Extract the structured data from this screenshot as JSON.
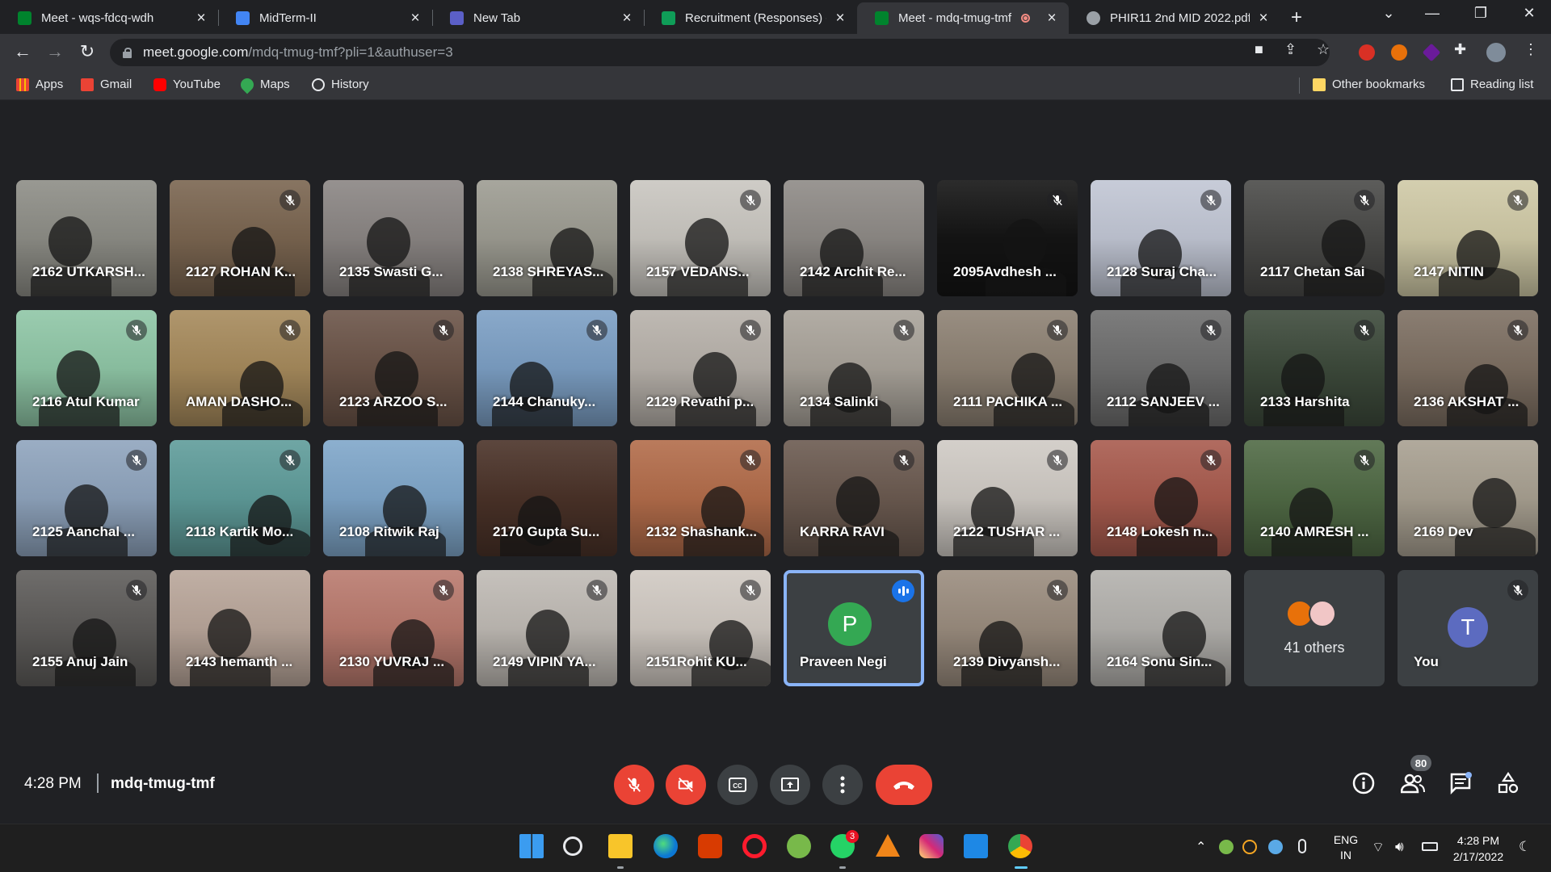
{
  "browser": {
    "tabs": [
      {
        "title": "Meet - wqs-fdcq-wdh",
        "active": false,
        "favicon_color": "#00832d"
      },
      {
        "title": "MidTerm-II",
        "active": false,
        "favicon_color": "#4285f4"
      },
      {
        "title": "New Tab",
        "active": false,
        "favicon_color": "#5b5fc7"
      },
      {
        "title": "Recruitment (Responses) - (",
        "active": false,
        "favicon_color": "#0f9d58"
      },
      {
        "title": "Meet - mdq-tmug-tmf",
        "active": true,
        "favicon_color": "#00832d"
      },
      {
        "title": "PHIR11 2nd MID 2022.pdf",
        "active": false,
        "favicon_color": "#9aa0a6"
      }
    ],
    "url_host": "meet.google.com",
    "url_path": "/mdq-tmug-tmf?pli=1&authuser=3",
    "bookmarks": [
      {
        "label": "Apps",
        "icon": "apps-grid-icon"
      },
      {
        "label": "Gmail",
        "icon": "gmail-icon"
      },
      {
        "label": "YouTube",
        "icon": "youtube-icon"
      },
      {
        "label": "Maps",
        "icon": "maps-icon"
      },
      {
        "label": "History",
        "icon": "history-icon"
      }
    ],
    "other_bookmarks": "Other bookmarks",
    "reading_list": "Reading list"
  },
  "meeting": {
    "time": "4:28 PM",
    "code": "mdq-tmug-tmf",
    "participant_count": "80",
    "others_label": "41 others",
    "you_label": "You",
    "you_initial": "T",
    "speaker_initial": "P"
  },
  "participants": [
    {
      "name": "2162 UTKARSH...",
      "muted": false,
      "bg": "#8d8d86"
    },
    {
      "name": "2127 ROHAN K...",
      "muted": true,
      "bg": "#7a6550"
    },
    {
      "name": "2135 Swasti G...",
      "muted": false,
      "bg": "#8a8583"
    },
    {
      "name": "2138 SHREYAS...",
      "muted": false,
      "bg": "#9d9c92"
    },
    {
      "name": "2157 VEDANS...",
      "muted": true,
      "bg": "#c9c6c0"
    },
    {
      "name": "2142 Archit Re...",
      "muted": false,
      "bg": "#8e8a86"
    },
    {
      "name": "2095Avdhesh ...",
      "muted": true,
      "bg": "#141414"
    },
    {
      "name": "2128 Suraj Cha...",
      "muted": true,
      "bg": "#c1c6d4"
    },
    {
      "name": "2117 Chetan Sai",
      "muted": true,
      "bg": "#4a4a48"
    },
    {
      "name": "2147 NITIN",
      "muted": true,
      "bg": "#cfc9a6"
    },
    {
      "name": "2116 Atul Kumar",
      "muted": true,
      "bg": "#8fc6a6"
    },
    {
      "name": "AMAN DASHO...",
      "muted": true,
      "bg": "#a68a5c"
    },
    {
      "name": "2123 ARZOO S...",
      "muted": true,
      "bg": "#6b5448"
    },
    {
      "name": "2144 Chanuky...",
      "muted": true,
      "bg": "#7c9fc4"
    },
    {
      "name": "2129 Revathi p...",
      "muted": true,
      "bg": "#b7b1aa"
    },
    {
      "name": "2134 Salinki",
      "muted": true,
      "bg": "#a9a39a"
    },
    {
      "name": "2111 PACHIKA ...",
      "muted": true,
      "bg": "#8d8173"
    },
    {
      "name": "2112 SANJEEV ...",
      "muted": true,
      "bg": "#6e6e6e"
    },
    {
      "name": "2133 Harshita",
      "muted": true,
      "bg": "#3d4a3b"
    },
    {
      "name": "2136 AKSHAT ...",
      "muted": true,
      "bg": "#7d6f62"
    },
    {
      "name": "2125 Aanchal ...",
      "muted": true,
      "bg": "#8fa4bd"
    },
    {
      "name": "2118 Kartik Mo...",
      "muted": true,
      "bg": "#5f9c9a"
    },
    {
      "name": "2108 Ritwik Raj",
      "muted": false,
      "bg": "#7fa6c9"
    },
    {
      "name": "2170 Gupta Su...",
      "muted": false,
      "bg": "#4a3228"
    },
    {
      "name": "2132 Shashank...",
      "muted": true,
      "bg": "#b26c4a"
    },
    {
      "name": "KARRA RAVI",
      "muted": true,
      "bg": "#6b5a50"
    },
    {
      "name": "2122 TUSHAR ...",
      "muted": true,
      "bg": "#cfcac4"
    },
    {
      "name": "2148 Lokesh n...",
      "muted": true,
      "bg": "#a85b4e"
    },
    {
      "name": "2140 AMRESH ...",
      "muted": true,
      "bg": "#506a45"
    },
    {
      "name": "2169 Dev",
      "muted": false,
      "bg": "#a8a091"
    },
    {
      "name": "2155 Anuj Jain",
      "muted": true,
      "bg": "#5e5c5a"
    },
    {
      "name": "2143 hemanth ...",
      "muted": false,
      "bg": "#b9a69a"
    },
    {
      "name": "2130 YUVRAJ ...",
      "muted": true,
      "bg": "#b97a6e"
    },
    {
      "name": "2149 VIPIN YA...",
      "muted": true,
      "bg": "#bfbab4"
    },
    {
      "name": "2151Rohit KU...",
      "muted": true,
      "bg": "#d0c9c2"
    },
    {
      "name": "Praveen Negi",
      "muted": false,
      "bg": "#3c4043"
    },
    {
      "name": "2139 Divyansh...",
      "muted": true,
      "bg": "#9a8c7e"
    },
    {
      "name": "2164 Sonu Sin...",
      "muted": false,
      "bg": "#b3b1ad"
    }
  ],
  "taskbar": {
    "language": "ENG",
    "region": "IN",
    "time": "4:28 PM",
    "date": "2/17/2022",
    "whatsapp_badge": "3"
  },
  "colors": {
    "background": "#202124",
    "red": "#ea4335",
    "blue": "#1a73e8",
    "avatar_green": "#34a853",
    "avatar_you": "#5c6bc0"
  }
}
